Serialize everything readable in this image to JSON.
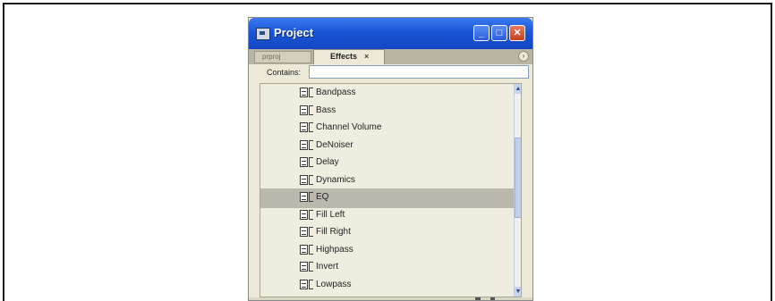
{
  "window": {
    "title": "Project",
    "minimize_label": "_",
    "maximize_label": "□",
    "close_label": "✕"
  },
  "tabs": [
    {
      "label": "prproj"
    },
    {
      "label": "Effects",
      "close": "×"
    }
  ],
  "panel_menu_icon": "›",
  "contains": {
    "label": "Contains:",
    "value": ""
  },
  "effects_list": {
    "items": [
      {
        "label": "Bandpass",
        "selected": false
      },
      {
        "label": "Bass",
        "selected": false
      },
      {
        "label": "Channel Volume",
        "selected": false
      },
      {
        "label": "DeNoiser",
        "selected": false
      },
      {
        "label": "Delay",
        "selected": false
      },
      {
        "label": "Dynamics",
        "selected": false
      },
      {
        "label": "EQ",
        "selected": true
      },
      {
        "label": "Fill Left",
        "selected": false
      },
      {
        "label": "Fill Right",
        "selected": false
      },
      {
        "label": "Highpass",
        "selected": false
      },
      {
        "label": "Invert",
        "selected": false
      },
      {
        "label": "Lowpass",
        "selected": false
      }
    ],
    "item_icon": "audio-effect-icon"
  },
  "scrollbar": {
    "up": "▲",
    "down": "▼"
  },
  "colors": {
    "titlebar": "#1a55d6",
    "selected_row": "#bbb9ad",
    "panel_bg": "#ece9d8",
    "close_button": "#c7411e"
  }
}
